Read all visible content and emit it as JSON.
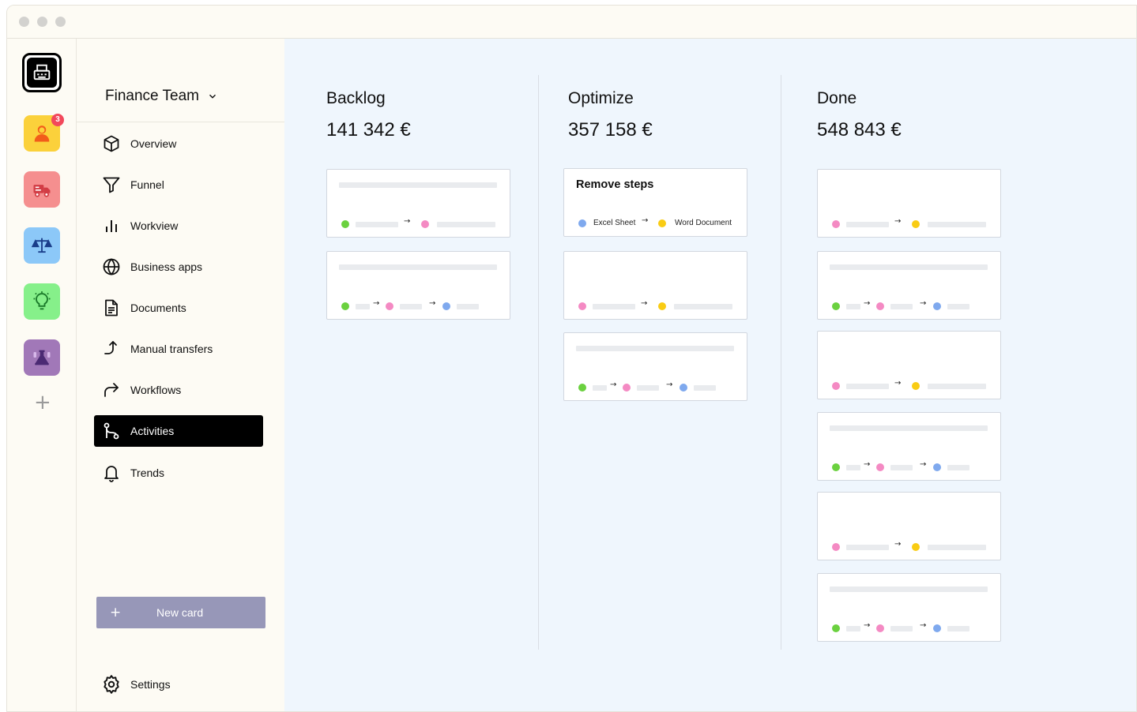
{
  "rail": {
    "notification_count": "3",
    "colors": {
      "home": "#000000",
      "person": "#fbd13b",
      "truck": "#f58f8f",
      "scale": "#8cc8f8",
      "bulb": "#86f08a",
      "lab": "#a178b8"
    }
  },
  "sidebar": {
    "team_name": "Finance Team",
    "items": [
      {
        "label": "Overview",
        "icon": "cube-icon"
      },
      {
        "label": "Funnel",
        "icon": "funnel-icon"
      },
      {
        "label": "Workview",
        "icon": "bar-chart-icon"
      },
      {
        "label": "Business apps",
        "icon": "globe-icon"
      },
      {
        "label": "Documents",
        "icon": "document-icon"
      },
      {
        "label": "Manual transfers",
        "icon": "transfer-icon"
      },
      {
        "label": "Workflows",
        "icon": "redirect-icon"
      },
      {
        "label": "Activities",
        "icon": "git-branch-icon"
      },
      {
        "label": "Trends",
        "icon": "bell-icon"
      }
    ],
    "active_item": "Activities",
    "new_card_label": "New card",
    "new_card_plus": "+",
    "settings_label": "Settings"
  },
  "board": {
    "columns": [
      {
        "title": "Backlog",
        "amount": "141 342 €"
      },
      {
        "title": "Optimize",
        "amount": "357 158 €"
      },
      {
        "title": "Done",
        "amount": "548 843 €"
      }
    ],
    "featured_card": {
      "title": "Remove steps",
      "from": "Excel Sheet",
      "to": "Word Document"
    },
    "arrow": "→",
    "dot_colors": {
      "green": "#6bd13f",
      "pink": "#f48ac3",
      "blue": "#7fa9ee",
      "yellow": "#f9cc14"
    }
  }
}
